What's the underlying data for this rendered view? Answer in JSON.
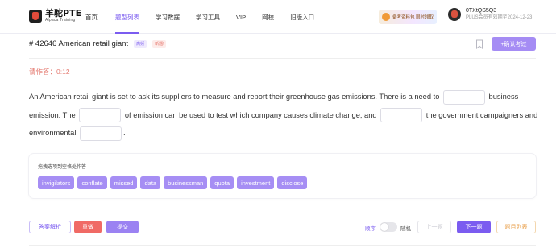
{
  "logo": {
    "name": "羊驼PTE",
    "sub": "Alpaca Training"
  },
  "nav": {
    "items": [
      {
        "label": "首页"
      },
      {
        "label": "题型列表",
        "active": true
      },
      {
        "label": "学习数据"
      },
      {
        "label": "学习工具"
      },
      {
        "label": "VIP"
      },
      {
        "label": "网校"
      },
      {
        "label": "旧版入口"
      }
    ]
  },
  "promo": {
    "text": "备考资料包 限时领取"
  },
  "user": {
    "name": "0TXtQS5Q3",
    "vip_status": "PLUS会员有效期至2024-12-23"
  },
  "question": {
    "id_title": "# 42646  American retail giant",
    "tag_high": "高频",
    "tag_new": "新题!",
    "add_label": "+确认考过"
  },
  "timer": {
    "text": "请作答：0:12"
  },
  "passage": {
    "seg1": "An American retail giant is set to ask its suppliers to measure and report their greenhouse gas emissions. There is a need to",
    "seg2": "business emission. The",
    "seg3": "of emission can be used to test which company causes climate change, and",
    "seg4": "the government campaigners and environmental",
    "seg5": "."
  },
  "options": {
    "hint": "拖拽选项到空格处作答",
    "words": [
      "invigilators",
      "conflate",
      "missed",
      "data",
      "businessman",
      "quota",
      "investment",
      "disclose"
    ]
  },
  "controls": {
    "analysis_label": "答案解析",
    "redo_label": "重做",
    "submit_label": "提交",
    "order_label": "顺序",
    "random_label": "随机",
    "prev_label": "上一题",
    "next_label": "下一题",
    "list_label": "题目列表"
  },
  "colors": {
    "accent": "#7b5cf0",
    "danger": "#f06a65",
    "chip": "#a68ef4"
  }
}
